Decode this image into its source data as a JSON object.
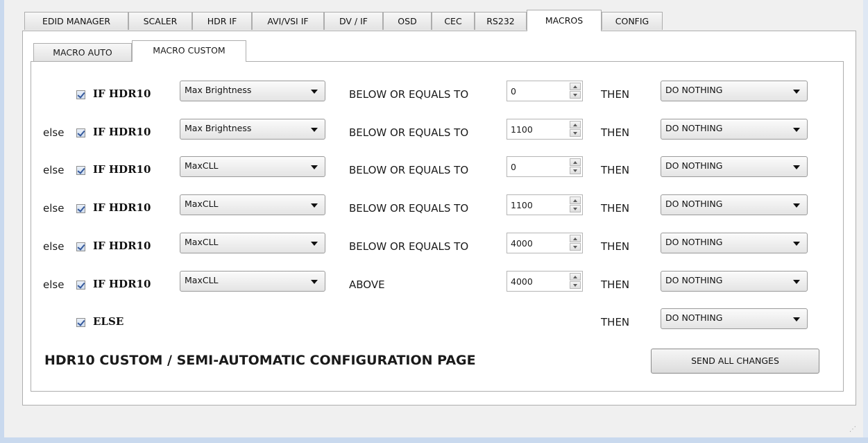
{
  "tabs": [
    {
      "label": "EDID MANAGER",
      "active": false
    },
    {
      "label": "SCALER",
      "active": false
    },
    {
      "label": "HDR IF",
      "active": false
    },
    {
      "label": "AVI/VSI IF",
      "active": false
    },
    {
      "label": "DV / IF",
      "active": false
    },
    {
      "label": "OSD",
      "active": false
    },
    {
      "label": "CEC",
      "active": false
    },
    {
      "label": "RS232",
      "active": false
    },
    {
      "label": "MACROS",
      "active": true
    },
    {
      "label": "CONFIG",
      "active": false
    }
  ],
  "sub_tabs": [
    {
      "label": "MACRO AUTO",
      "active": false
    },
    {
      "label": "MACRO CUSTOM",
      "active": true
    }
  ],
  "rows": [
    {
      "else": "",
      "checked": true,
      "condition": "IF HDR10",
      "param": "Max Brightness",
      "comparator": "BELOW OR EQUALS TO",
      "value": "0",
      "then": "THEN",
      "action": "DO NOTHING"
    },
    {
      "else": "else",
      "checked": true,
      "condition": "IF HDR10",
      "param": "Max Brightness",
      "comparator": "BELOW OR EQUALS TO",
      "value": "1100",
      "then": "THEN",
      "action": "DO NOTHING"
    },
    {
      "else": "else",
      "checked": true,
      "condition": "IF HDR10",
      "param": "MaxCLL",
      "comparator": "BELOW OR EQUALS TO",
      "value": "0",
      "then": "THEN",
      "action": "DO NOTHING"
    },
    {
      "else": "else",
      "checked": true,
      "condition": "IF HDR10",
      "param": "MaxCLL",
      "comparator": "BELOW OR EQUALS TO",
      "value": "1100",
      "then": "THEN",
      "action": "DO NOTHING"
    },
    {
      "else": "else",
      "checked": true,
      "condition": "IF HDR10",
      "param": "MaxCLL",
      "comparator": "BELOW OR EQUALS TO",
      "value": "4000",
      "then": "THEN",
      "action": "DO NOTHING"
    },
    {
      "else": "else",
      "checked": true,
      "condition": "IF HDR10",
      "param": "MaxCLL",
      "comparator": "ABOVE",
      "value": "4000",
      "then": "THEN",
      "action": "DO NOTHING"
    }
  ],
  "else_row": {
    "checked": true,
    "label": "ELSE",
    "then": "THEN",
    "action": "DO NOTHING"
  },
  "page_title": "HDR10 CUSTOM / SEMI-AUTOMATIC CONFIGURATION PAGE",
  "send_button": "SEND ALL CHANGES",
  "colors": {
    "checkmark": "#34589c",
    "panel": "#ffffff",
    "background": "#f0f0f0",
    "window_frame": "#c9d9ee"
  }
}
